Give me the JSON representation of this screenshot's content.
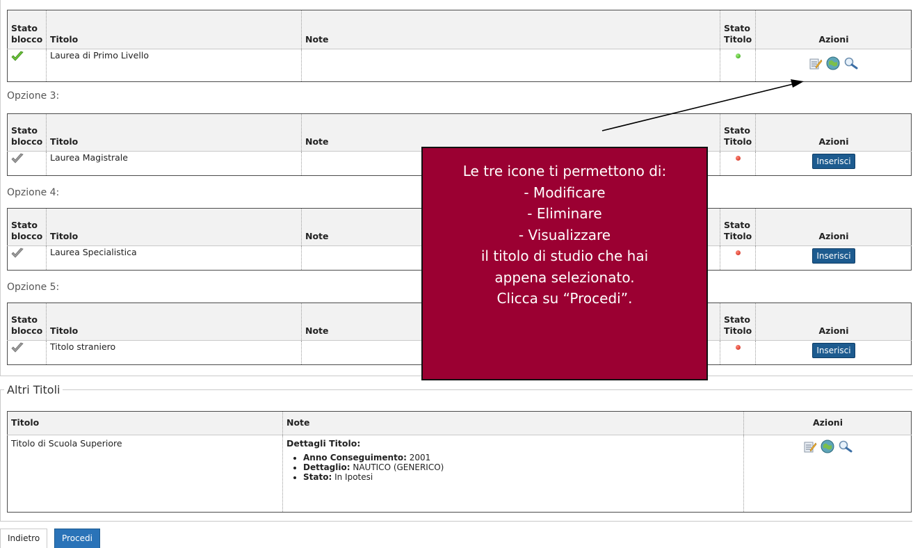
{
  "headers": {
    "stato_blocco_1": "Stato",
    "stato_blocco_2": "blocco",
    "titolo": "Titolo",
    "note": "Note",
    "stato_titolo_1": "Stato",
    "stato_titolo_2": "Titolo",
    "azioni": "Azioni"
  },
  "blocks": [
    {
      "option_label": "",
      "titolo": "Laurea di Primo Livello",
      "stato_blocco": "green-check-icon",
      "stato_titolo": "green",
      "action": "icons"
    },
    {
      "option_label": "Opzione 3:",
      "titolo": "Laurea Magistrale",
      "stato_blocco": "gray-check-icon",
      "stato_titolo": "red",
      "action": "Inserisci"
    },
    {
      "option_label": "Opzione 4:",
      "titolo": "Laurea Specialistica",
      "stato_blocco": "gray-check-icon",
      "stato_titolo": "red",
      "action": "Inserisci"
    },
    {
      "option_label": "Opzione 5:",
      "titolo": "Titolo straniero",
      "stato_blocco": "gray-check-icon",
      "stato_titolo": "red",
      "action": "Inserisci"
    }
  ],
  "inserisci_label": "Inserisci",
  "altri": {
    "legend": "Altri Titoli",
    "headers": {
      "titolo": "Titolo",
      "note": "Note",
      "azioni": "Azioni"
    },
    "row": {
      "titolo": "Titolo di Scuola Superiore",
      "dettagli_heading": "Dettagli Titolo:",
      "details": [
        {
          "key": "Anno Conseguimento:",
          "value": " 2001"
        },
        {
          "key": "Dettaglio:",
          "value": " NAUTICO (GENERICO)"
        },
        {
          "key": "Stato:",
          "value": " In Ipotesi"
        }
      ]
    }
  },
  "overlay_lines": [
    "Le tre icone ti permettono di:",
    "- Modificare",
    "- Eliminare",
    "- Visualizzare",
    "il titolo di studio che hai",
    "appena selezionato.",
    "Clicca su “Procedi”."
  ],
  "buttons": {
    "back": "Indietro",
    "next": "Procedi"
  },
  "icons": [
    "edit-icon",
    "delete-icon",
    "view-icon"
  ],
  "colors": {
    "overlay": "#9b0032",
    "button_blue": "#1d5b8f",
    "procedi_blue": "#2a73b8"
  }
}
